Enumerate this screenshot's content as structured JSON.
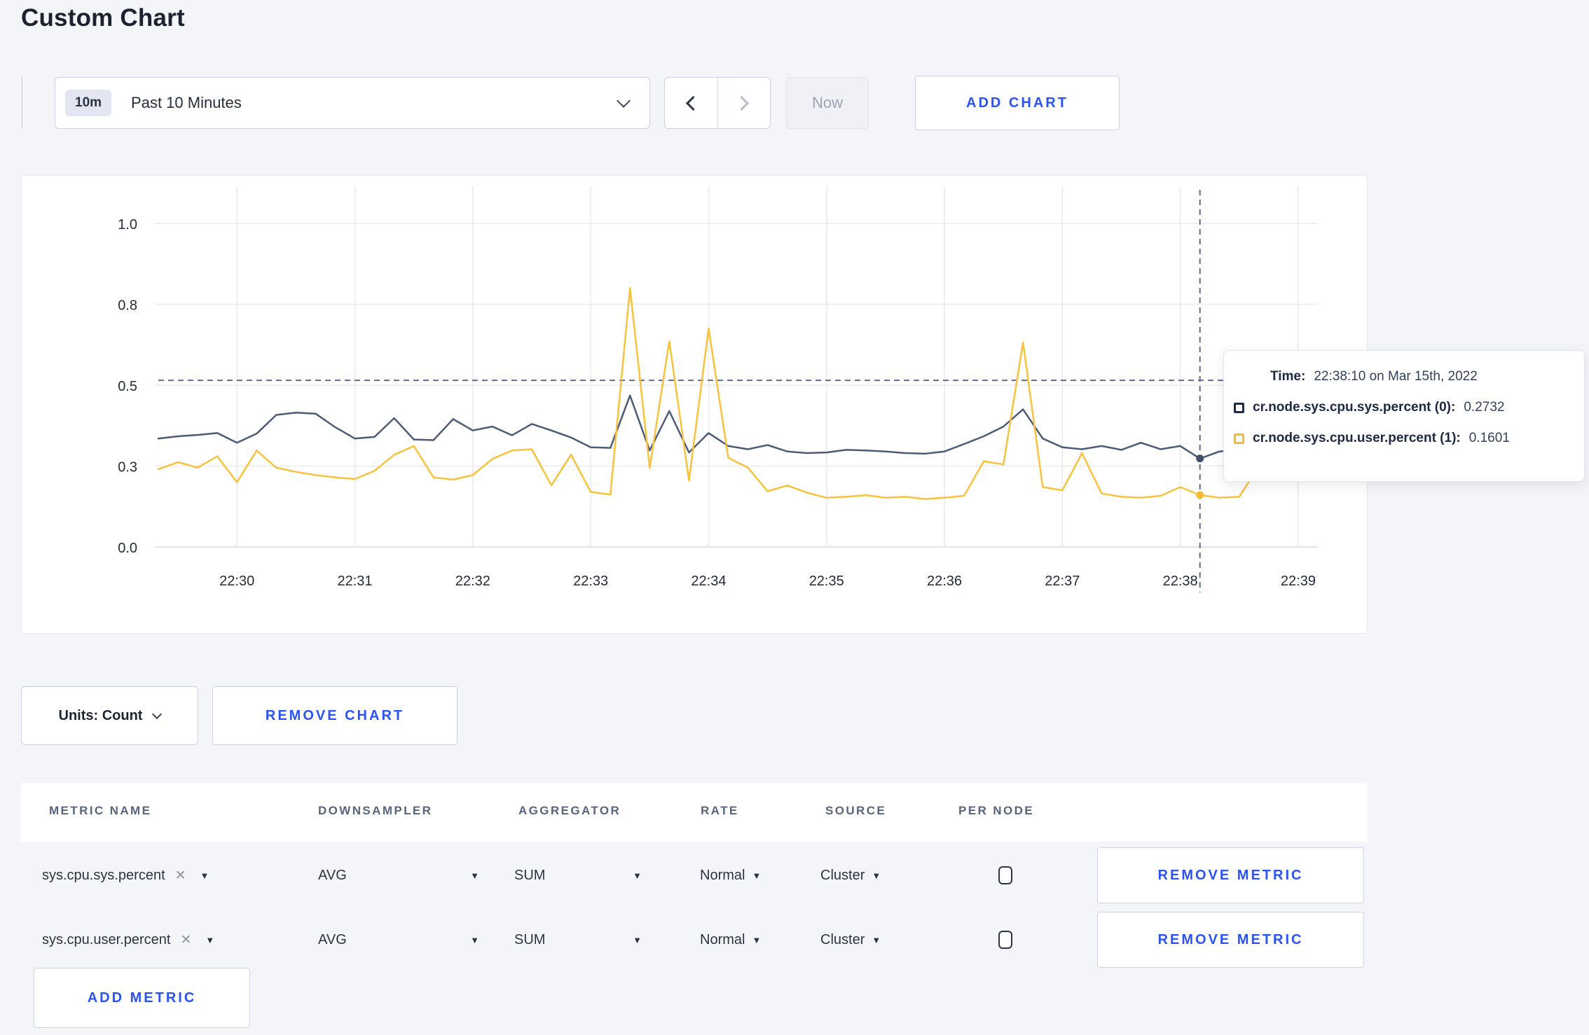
{
  "page": {
    "title": "Custom Chart",
    "background": "#f4f5f9",
    "accent_blue": "#2a53f5"
  },
  "toolbar": {
    "time_range": {
      "badge": "10m",
      "label": "Past 10 Minutes"
    },
    "now_label": "Now",
    "add_chart_label": "ADD CHART"
  },
  "icons": {
    "triangle": "▼",
    "clear": "✕"
  },
  "tooltip": {
    "time_label": "Time:",
    "time_value": "22:38:10 on Mar 15th, 2022",
    "rows": [
      {
        "label": "cr.node.sys.cpu.sys.percent (0):",
        "value": "0.2732",
        "swatch_color": "#1c2b4a"
      },
      {
        "label": "cr.node.sys.cpu.user.percent (1):",
        "value": "0.1601",
        "swatch_color": "#f5ba30"
      }
    ]
  },
  "controls": {
    "units_label": "Units: Count",
    "remove_chart_label": "REMOVE CHART",
    "remove_metric_label": "REMOVE METRIC",
    "add_metric_label": "ADD METRIC"
  },
  "metrics_table": {
    "headers": [
      "METRIC NAME",
      "DOWNSAMPLER",
      "AGGREGATOR",
      "RATE",
      "SOURCE",
      "PER NODE"
    ],
    "rows": [
      {
        "name": "sys.cpu.sys.percent",
        "downsampler": "AVG",
        "aggregator": "SUM",
        "rate": "Normal",
        "source": "Cluster",
        "per_node": false
      },
      {
        "name": "sys.cpu.user.percent",
        "downsampler": "AVG",
        "aggregator": "SUM",
        "rate": "Normal",
        "source": "Cluster",
        "per_node": false
      }
    ]
  },
  "chart_data": {
    "type": "line",
    "title": "",
    "xlabel": "",
    "ylabel": "",
    "ylim": [
      0,
      1
    ],
    "grid": true,
    "grid_color": "#e9eaef",
    "crosshair_color": "#5d6d89",
    "x_start": "22:29:20",
    "x_step_seconds": 10,
    "x_first_tick_offset_seconds": 40,
    "x_ticks": [
      "22:30",
      "22:31",
      "22:32",
      "22:33",
      "22:34",
      "22:35",
      "22:36",
      "22:37",
      "22:38",
      "22:39"
    ],
    "y_ticks": [
      {
        "v": 0.0,
        "label": "0.0"
      },
      {
        "v": 0.25,
        "label": "0.3"
      },
      {
        "v": 0.5,
        "label": "0.5"
      },
      {
        "v": 0.75,
        "label": "0.8"
      },
      {
        "v": 1.0,
        "label": "1.0"
      }
    ],
    "crosshair": {
      "time": "22:38:10",
      "x_index": 53,
      "y_value": 0.515
    },
    "series": [
      {
        "name": "cr.node.sys.cpu.sys.percent (0)",
        "color": "#4c5b77",
        "marker_color": "#42526e",
        "values": [
          0.335,
          0.342,
          0.346,
          0.352,
          0.322,
          0.35,
          0.408,
          0.415,
          0.412,
          0.37,
          0.335,
          0.34,
          0.398,
          0.332,
          0.33,
          0.395,
          0.36,
          0.372,
          0.345,
          0.38,
          0.36,
          0.338,
          0.308,
          0.306,
          0.468,
          0.298,
          0.42,
          0.292,
          0.352,
          0.312,
          0.302,
          0.315,
          0.295,
          0.29,
          0.292,
          0.3,
          0.298,
          0.295,
          0.29,
          0.288,
          0.295,
          0.318,
          0.342,
          0.372,
          0.425,
          0.335,
          0.308,
          0.302,
          0.312,
          0.3,
          0.322,
          0.302,
          0.312,
          0.2732,
          0.295,
          0.3,
          0.298,
          0.295,
          0.3,
          0.305
        ]
      },
      {
        "name": "cr.node.sys.cpu.user.percent (1)",
        "color": "#f8c23d",
        "marker_color": "#f6bd33",
        "values": [
          0.24,
          0.262,
          0.245,
          0.28,
          0.2,
          0.298,
          0.245,
          0.232,
          0.222,
          0.215,
          0.21,
          0.235,
          0.285,
          0.312,
          0.215,
          0.208,
          0.222,
          0.272,
          0.298,
          0.302,
          0.19,
          0.285,
          0.17,
          0.162,
          0.8,
          0.245,
          0.635,
          0.205,
          0.675,
          0.275,
          0.245,
          0.172,
          0.19,
          0.168,
          0.152,
          0.155,
          0.16,
          0.152,
          0.155,
          0.148,
          0.152,
          0.158,
          0.265,
          0.255,
          0.632,
          0.185,
          0.175,
          0.29,
          0.165,
          0.155,
          0.152,
          0.158,
          0.185,
          0.1601,
          0.152,
          0.155,
          0.25,
          0.3,
          0.205,
          0.27
        ]
      }
    ],
    "legend_position": "tooltip"
  }
}
